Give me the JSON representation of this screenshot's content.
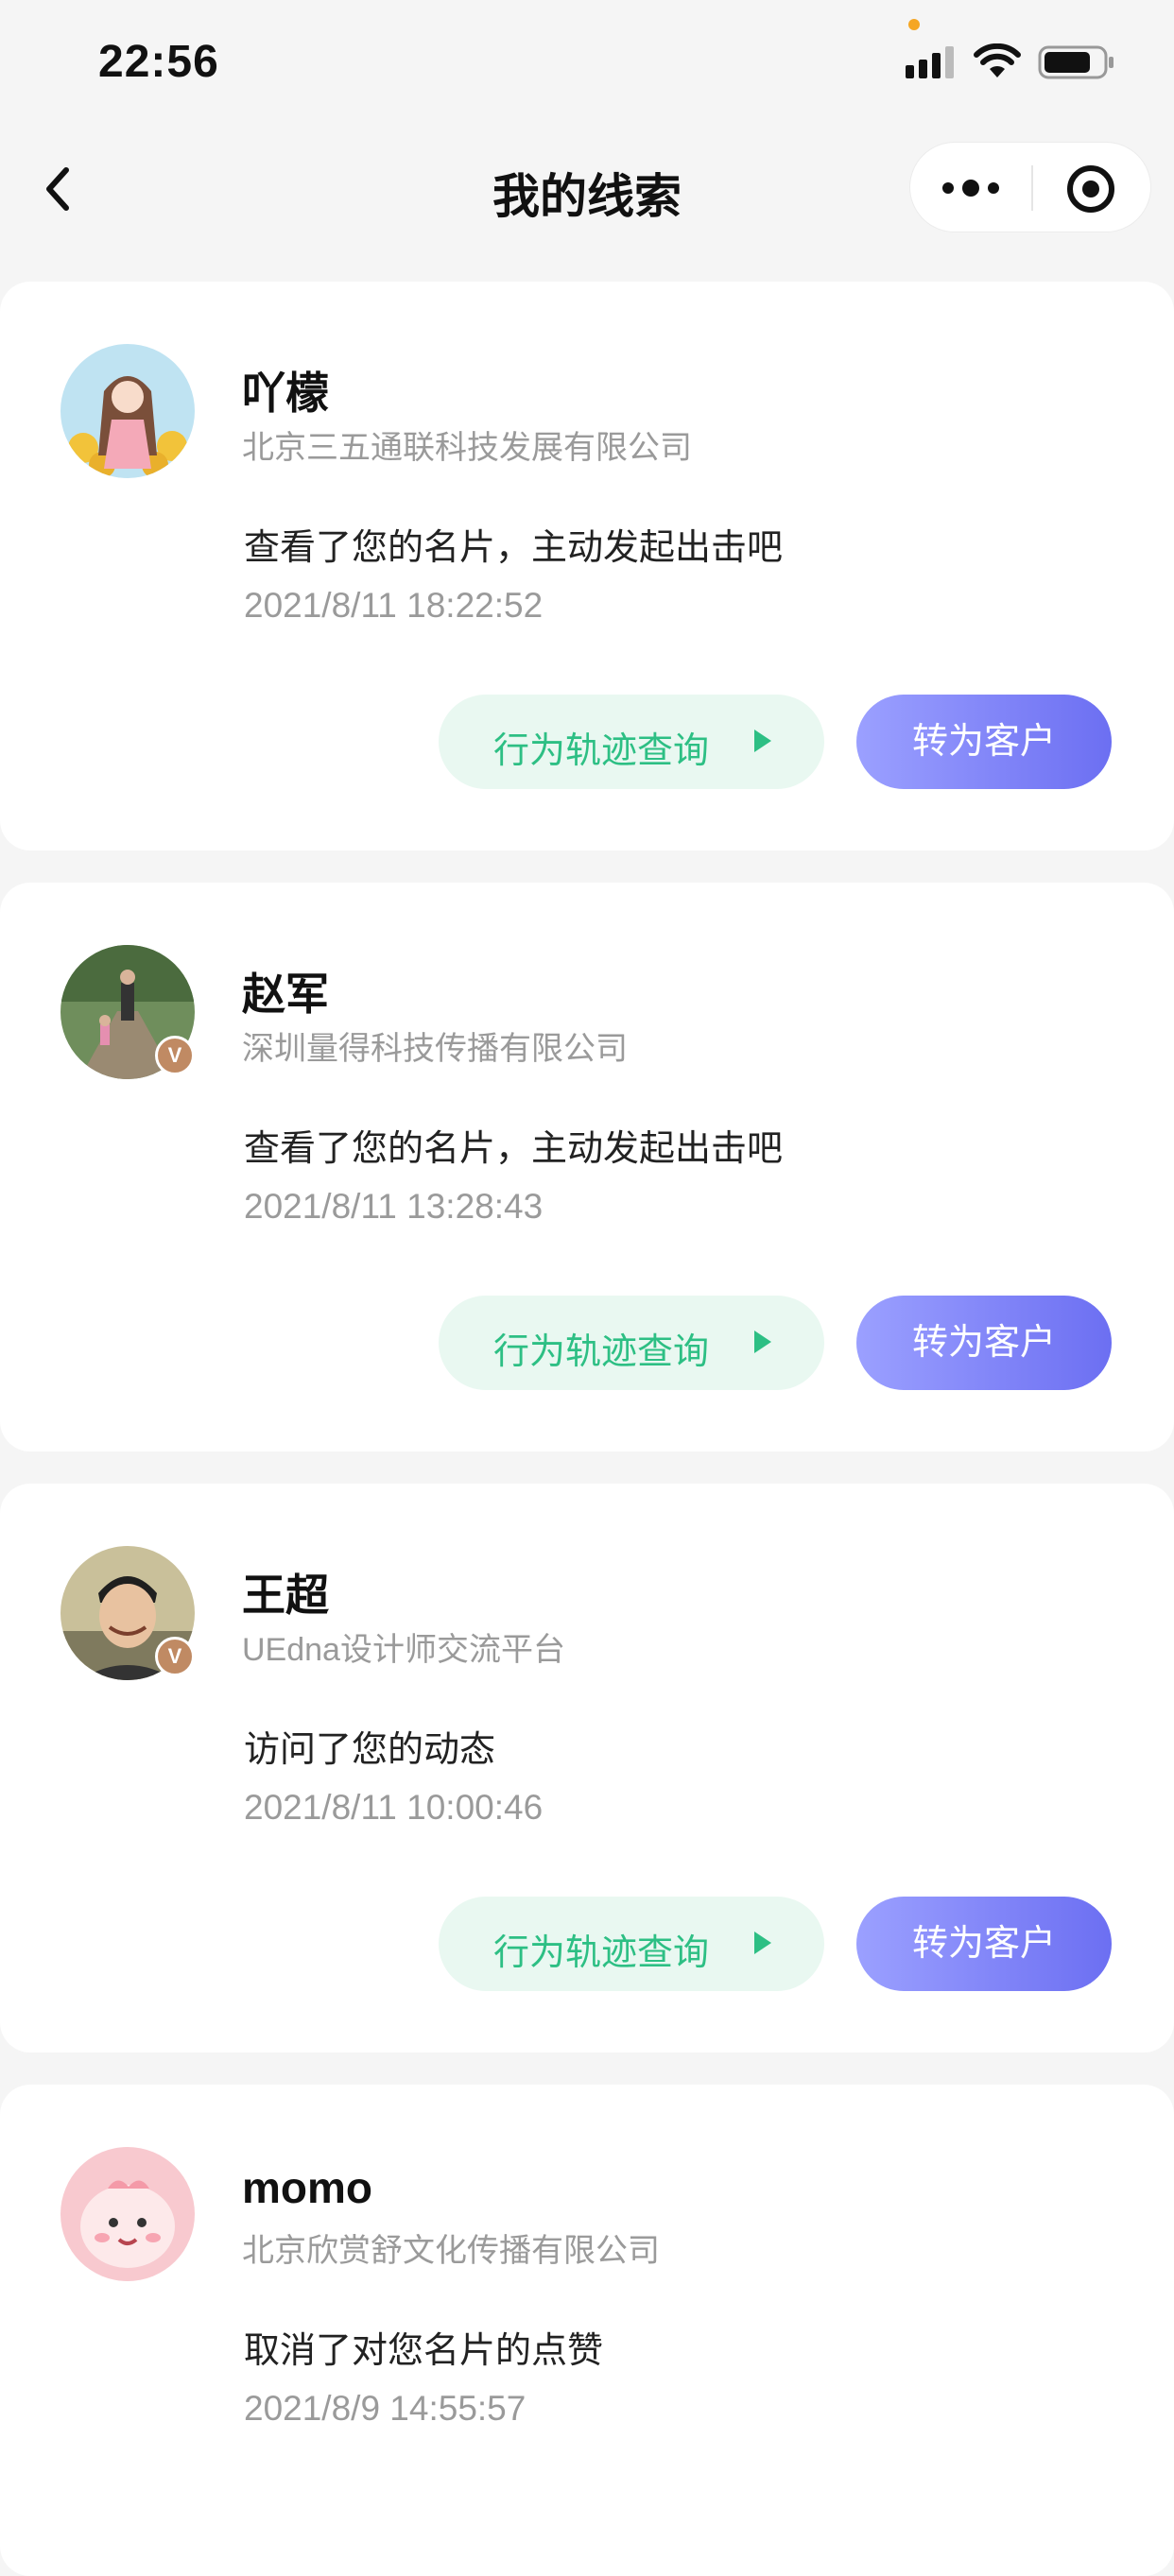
{
  "status_bar": {
    "time": "22:56"
  },
  "nav": {
    "title": "我的线索"
  },
  "leads": [
    {
      "name": "吖檬",
      "company": "北京三五通联科技发展有限公司",
      "action": "查看了您的名片，主动发起出击吧",
      "time": "2021/8/11 18:22:52",
      "track_label": "行为轨迹查询",
      "convert_label": "转为客户",
      "verified": false
    },
    {
      "name": "赵军",
      "company": "深圳量得科技传播有限公司",
      "action": "查看了您的名片，主动发起出击吧",
      "time": "2021/8/11 13:28:43",
      "track_label": "行为轨迹查询",
      "convert_label": "转为客户",
      "verified": true,
      "badge": "V"
    },
    {
      "name": "王超",
      "company": "UEdna设计师交流平台",
      "action": "访问了您的动态",
      "time": "2021/8/11 10:00:46",
      "track_label": "行为轨迹查询",
      "convert_label": "转为客户",
      "verified": true,
      "badge": "V"
    },
    {
      "name": "momo",
      "company": "北京欣赏舒文化传播有限公司",
      "action": "取消了对您名片的点赞",
      "time": "2021/8/9 14:55:57",
      "verified": false
    }
  ],
  "colors": {
    "accent_green": "#2dbf84",
    "accent_purple": "#6c6ff2",
    "badge": "#c08a63"
  }
}
